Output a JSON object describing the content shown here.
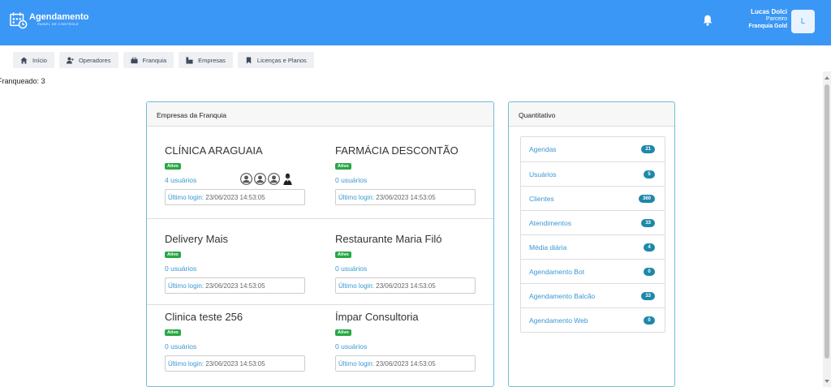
{
  "header": {
    "brand_title": "Agendamento",
    "brand_subtitle": "PAINEL DE CONTROLE",
    "user_name": "Lucas Dolci",
    "user_role": "Parceiro",
    "user_plan": "Franquia Gold",
    "avatar_letter": "L"
  },
  "nav": [
    {
      "label": "Início",
      "icon": "home-icon"
    },
    {
      "label": "Operadores",
      "icon": "user-plus-icon"
    },
    {
      "label": "Franquia",
      "icon": "briefcase-icon"
    },
    {
      "label": "Empresas",
      "icon": "building-icon"
    },
    {
      "label": "Licenças e Planos",
      "icon": "bookmark-icon"
    }
  ],
  "franqueado_text": "Franqueado: 3",
  "empresas_panel": {
    "title": "Empresas da Franquia",
    "login_label": "Último login:",
    "companies": [
      {
        "name": "CLÍNICA ARAGUAIA",
        "status": "Ativo",
        "users": "4 usuários",
        "last_login": "23/06/2023 14:53:05"
      },
      {
        "name": "FARMÁCIA DESCONTÃO",
        "status": "Ativo",
        "users": "0 usuários",
        "last_login": "23/06/2023 14:53:05"
      },
      {
        "name": "Delivery Mais",
        "status": "Ativo",
        "users": "0 usuários",
        "last_login": "23/06/2023 14:53:05"
      },
      {
        "name": "Restaurante Maria Filó",
        "status": "Ativo",
        "users": "0 usuários",
        "last_login": "23/06/2023 14:53:05"
      },
      {
        "name": "Clinica teste 256",
        "status": "Ativo",
        "users": "0 usuários",
        "last_login": "23/06/2023 14:53:05"
      },
      {
        "name": "Ímpar Consultoria",
        "status": "Ativo",
        "users": "0 usuários",
        "last_login": "23/06/2023 14:53:05"
      }
    ]
  },
  "quantitativo_panel": {
    "title": "Quantitativo",
    "items": [
      {
        "label": "Agendas",
        "count": "21"
      },
      {
        "label": "Usuários",
        "count": "5"
      },
      {
        "label": "Clientes",
        "count": "360"
      },
      {
        "label": "Atendimentos",
        "count": "33"
      },
      {
        "label": "Média diária",
        "count": "4"
      },
      {
        "label": "Agendamento Bot",
        "count": "0"
      },
      {
        "label": "Agendamento Balcão",
        "count": "33"
      },
      {
        "label": "Agendamento Web",
        "count": "0"
      }
    ]
  },
  "colors": {
    "topbar": "#3b97f5",
    "ativo": "#28a745",
    "pill": "#1e88a8",
    "link": "#3a98d4",
    "panel_border": "#6bbfd6"
  }
}
